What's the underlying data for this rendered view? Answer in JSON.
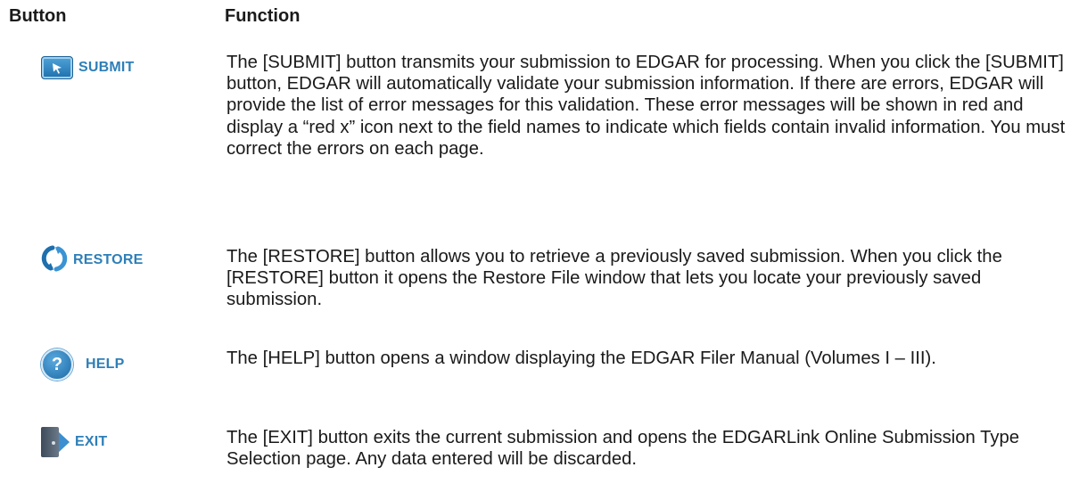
{
  "headers": {
    "button": "Button",
    "function": "Function"
  },
  "rows": [
    {
      "icon": "submit-icon",
      "label": "SUBMIT",
      "description": "The [SUBMIT] button transmits your submission to EDGAR for processing. When you click the [SUBMIT] button, EDGAR will automatically validate your submission information. If there are errors, EDGAR will provide the list of error messages for this validation. These error messages will be shown in red and display a “red x” icon next to the field names to indicate which fields contain invalid information. You must correct the errors on each page."
    },
    {
      "icon": "restore-icon",
      "label": "RESTORE",
      "description": "The [RESTORE] button allows you to retrieve a previously saved submission. When you click the [RESTORE] button it opens the Restore File window that lets you locate your previously saved submission."
    },
    {
      "icon": "help-icon",
      "label": "HELP",
      "description": "The [HELP] button opens a window displaying the EDGAR Filer Manual (Volumes I – III)."
    },
    {
      "icon": "exit-icon",
      "label": "EXIT",
      "description": "The [EXIT] button exits the current submission and opens the EDGARLink Online Submission Type Selection page. Any data entered will be discarded."
    }
  ],
  "colors": {
    "button_label": "#2e7fb8",
    "icon_blue": "#1e6fae",
    "text": "#1a1a1a"
  }
}
